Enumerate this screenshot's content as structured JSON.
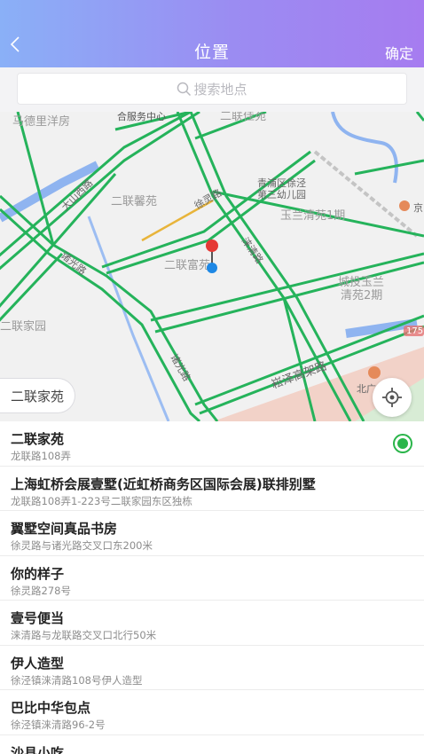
{
  "header": {
    "title": "位置",
    "confirm_label": "确定"
  },
  "search": {
    "placeholder": "搜索地点"
  },
  "map": {
    "chip_label": "二联家苑",
    "labels": {
      "madeli": "马德里洋房",
      "hefu": "合服务中心",
      "erlianjia_top": "二联佳苑",
      "erlianxin": "二联馨苑",
      "erlianfu": "二联富苑",
      "erlianjiayuan": "二联家园",
      "qingpu1": "青浦区徐泾",
      "qingpu2": "第三幼儿园",
      "yulan1": "玉兰清苑1期",
      "chengtou1": "城投玉兰",
      "chengtou2": "清苑2期",
      "dashanxi": "大山西路",
      "zhuguang": "诸光路",
      "xuling": "徐灵路",
      "laiqing": "涞清路",
      "zhuguang2": "诸光路",
      "songze": "崧泽高架路",
      "bei": "北广",
      "road_no": "175",
      "jing": "京"
    },
    "colors": {
      "road": "#25b35b",
      "water": "#8fb4f0",
      "highway_yellow": "#e8b43a",
      "pin_red": "#e53935",
      "pin_blue": "#1e88e5"
    }
  },
  "places": [
    {
      "name": "二联家苑",
      "address": "龙联路108弄",
      "selected": true
    },
    {
      "name": "上海虹桥会展壹墅(近虹桥商务区国际会展)联排别墅",
      "address": "龙联路108弄1-223号二联家园东区独栋",
      "selected": false
    },
    {
      "name": "翼墅空间真品书房",
      "address": "徐灵路与诸光路交叉口东200米",
      "selected": false
    },
    {
      "name": "你的样子",
      "address": "徐灵路278号",
      "selected": false
    },
    {
      "name": "壹号便当",
      "address": "涞清路与龙联路交叉口北行50米",
      "selected": false
    },
    {
      "name": "伊人造型",
      "address": "徐泾镇涞清路108号伊人造型",
      "selected": false
    },
    {
      "name": "巴比中华包点",
      "address": "徐泾镇涞清路96-2号",
      "selected": false
    },
    {
      "name": "沙县小吃",
      "address": "",
      "selected": false
    }
  ]
}
